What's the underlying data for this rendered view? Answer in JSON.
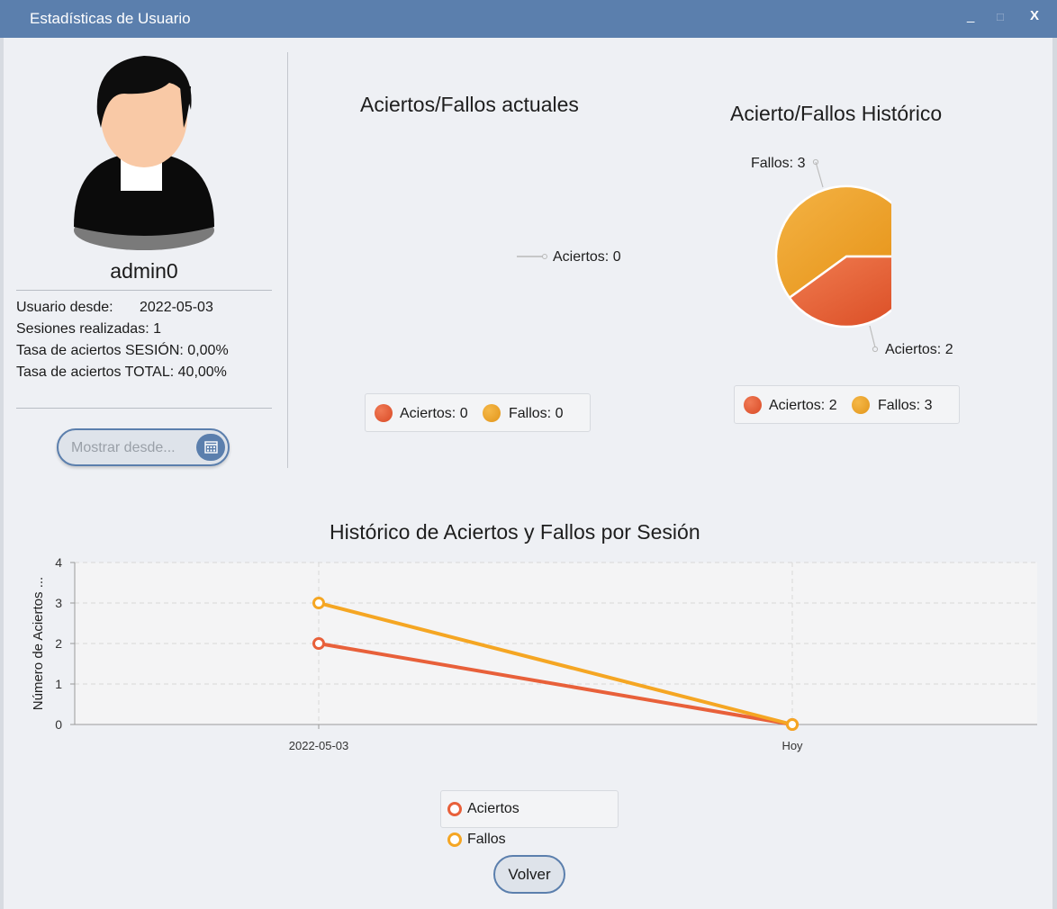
{
  "window": {
    "title": "Estadísticas de Usuario",
    "minimize": "_",
    "maximize": "□",
    "close": "X"
  },
  "profile": {
    "username": "admin0",
    "user_since_label": "Usuario desde:",
    "user_since_value": "2022-05-03",
    "sessions": "Sesiones realizadas: 1",
    "session_rate": "Tasa de aciertos SESIÓN: 0,00%",
    "total_rate": "Tasa de aciertos TOTAL: 40,00%"
  },
  "date_picker": {
    "placeholder": "Mostrar desde...",
    "icon": "calendar-icon"
  },
  "current_chart": {
    "title": "Aciertos/Fallos actuales",
    "slice_label": "Aciertos: 0",
    "legend": [
      "Aciertos: 0",
      "Fallos: 0"
    ]
  },
  "history_pie": {
    "title": "Acierto/Fallos Histórico",
    "label_fallos": "Fallos: 3",
    "label_aciertos": "Aciertos: 2",
    "legend": [
      "Aciertos: 2",
      "Fallos: 3"
    ]
  },
  "line_chart": {
    "title": "Histórico de Aciertos y Fallos por Sesión",
    "ylabel": "Número de Aciertos ...",
    "yticks": [
      "0",
      "1",
      "2",
      "3",
      "4"
    ],
    "legend": [
      "Aciertos",
      "Fallos"
    ]
  },
  "colors": {
    "aciertos": "#e8603a",
    "fallos": "#f5a623",
    "accent": "#5b7fad"
  },
  "buttons": {
    "volver": "Volver"
  },
  "chart_data": [
    {
      "type": "pie",
      "title": "Aciertos/Fallos actuales",
      "categories": [
        "Aciertos",
        "Fallos"
      ],
      "values": [
        0,
        0
      ]
    },
    {
      "type": "pie",
      "title": "Acierto/Fallos Histórico",
      "categories": [
        "Aciertos",
        "Fallos"
      ],
      "values": [
        2,
        3
      ]
    },
    {
      "type": "line",
      "title": "Histórico de Aciertos y Fallos por Sesión",
      "categories": [
        "2022-05-03",
        "Hoy"
      ],
      "series": [
        {
          "name": "Aciertos",
          "values": [
            2,
            0
          ]
        },
        {
          "name": "Fallos",
          "values": [
            3,
            0
          ]
        }
      ],
      "ylabel": "Número de Aciertos ...",
      "ylim": [
        0,
        4
      ],
      "grid": true,
      "legend": "bottom"
    }
  ]
}
